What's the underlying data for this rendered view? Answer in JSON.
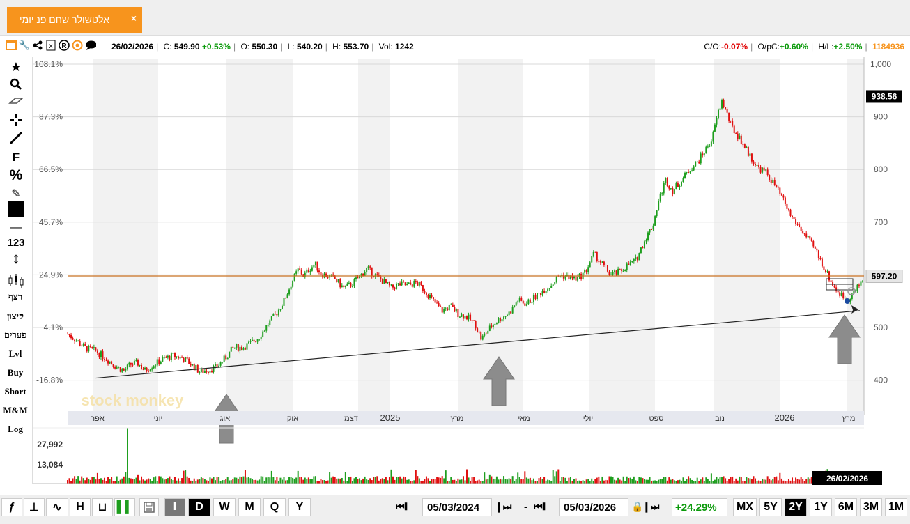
{
  "tab": {
    "title": "אלטשולר שחם פנ יומי",
    "close": "×"
  },
  "header": {
    "date": "26/02/2026",
    "close_label": "C:",
    "close": "549.90",
    "close_change": "+0.53%",
    "open_label": "O:",
    "open": "550.30",
    "low_label": "L:",
    "low": "540.20",
    "high_label": "H:",
    "high": "553.70",
    "vol_label": "Vol:",
    "vol": "1242",
    "co_label": "C/O:",
    "co": "-0.07%",
    "opc_label": "O/pC:",
    "opc": "+0.60%",
    "hl_label": "H/L:",
    "hl": "+2.50%",
    "id": "1184936"
  },
  "left_tools": [
    {
      "name": "star-icon",
      "label": "★"
    },
    {
      "name": "zoom-icon",
      "label": "🔍"
    },
    {
      "name": "eraser-icon",
      "label": "⌫"
    },
    {
      "name": "crosshair-icon",
      "label": "✛"
    },
    {
      "name": "line-tool-icon",
      "label": "╱"
    },
    {
      "name": "fib-tool",
      "label": "F"
    },
    {
      "name": "percent-tool",
      "label": "%"
    },
    {
      "name": "edit-icon",
      "label": "✎"
    },
    {
      "name": "color-swatch",
      "label": ""
    },
    {
      "name": "line-width-icon",
      "label": "—"
    },
    {
      "name": "number-tool",
      "label": "123"
    },
    {
      "name": "vertical-arrow-icon",
      "label": "↕"
    },
    {
      "name": "candle-icon",
      "label": "⫼"
    }
  ],
  "left_words": [
    "רצף",
    "קיצון",
    "פערים",
    "Lvl",
    "Buy",
    "Short",
    "M&M",
    "Log"
  ],
  "watermark": "stock monkey",
  "colors": {
    "up": "#1e9e1e",
    "down": "#e01010",
    "orange": "#f7941d",
    "hline": "#c87020",
    "arrow": "#8c8c8c"
  },
  "chart_data": {
    "type": "candlestick",
    "x_range": [
      "2024-03-05",
      "2026-03-05"
    ],
    "y_right_ticks": [
      "1,000",
      "900",
      "800",
      "700",
      "600",
      "500",
      "400"
    ],
    "y_left_ticks": [
      "108.1%",
      "87.3%",
      "66.5%",
      "45.7%",
      "24.9%",
      "4.1%",
      "-16.8%"
    ],
    "x_ticks": [
      "אפר",
      "יוני",
      "אוג",
      "אוק",
      "דצמ",
      "2025",
      "מרץ",
      "מאי",
      "יולי",
      "ספט",
      "נוב",
      "2026",
      "מרץ"
    ],
    "close_series": [
      [
        0,
        488
      ],
      [
        5,
        478
      ],
      [
        12,
        462
      ],
      [
        20,
        455
      ],
      [
        28,
        440
      ],
      [
        35,
        425
      ],
      [
        40,
        418
      ],
      [
        45,
        430
      ],
      [
        50,
        432
      ],
      [
        55,
        418
      ],
      [
        60,
        428
      ],
      [
        68,
        440
      ],
      [
        75,
        446
      ],
      [
        82,
        442
      ],
      [
        88,
        430
      ],
      [
        94,
        416
      ],
      [
        100,
        420
      ],
      [
        106,
        425
      ],
      [
        112,
        442
      ],
      [
        118,
        462
      ],
      [
        124,
        462
      ],
      [
        130,
        470
      ],
      [
        136,
        482
      ],
      [
        142,
        505
      ],
      [
        148,
        525
      ],
      [
        154,
        552
      ],
      [
        160,
        590
      ],
      [
        164,
        610
      ],
      [
        168,
        598
      ],
      [
        172,
        612
      ],
      [
        176,
        620
      ],
      [
        180,
        602
      ],
      [
        185,
        598
      ],
      [
        190,
        592
      ],
      [
        196,
        575
      ],
      [
        202,
        582
      ],
      [
        208,
        598
      ],
      [
        213,
        612
      ],
      [
        218,
        600
      ],
      [
        224,
        588
      ],
      [
        230,
        575
      ],
      [
        236,
        582
      ],
      [
        242,
        580
      ],
      [
        248,
        585
      ],
      [
        254,
        570
      ],
      [
        260,
        550
      ],
      [
        266,
        532
      ],
      [
        272,
        540
      ],
      [
        278,
        525
      ],
      [
        284,
        520
      ],
      [
        290,
        505
      ],
      [
        294,
        478
      ],
      [
        298,
        492
      ],
      [
        303,
        508
      ],
      [
        308,
        518
      ],
      [
        314,
        528
      ],
      [
        320,
        552
      ],
      [
        326,
        545
      ],
      [
        332,
        558
      ],
      [
        338,
        570
      ],
      [
        344,
        582
      ],
      [
        350,
        600
      ],
      [
        356,
        596
      ],
      [
        362,
        592
      ],
      [
        368,
        605
      ],
      [
        374,
        640
      ],
      [
        380,
        620
      ],
      [
        386,
        600
      ],
      [
        392,
        605
      ],
      [
        398,
        618
      ],
      [
        404,
        628
      ],
      [
        410,
        665
      ],
      [
        416,
        695
      ],
      [
        420,
        740
      ],
      [
        425,
        780
      ],
      [
        430,
        760
      ],
      [
        436,
        778
      ],
      [
        442,
        800
      ],
      [
        448,
        815
      ],
      [
        454,
        840
      ],
      [
        458,
        858
      ],
      [
        462,
        905
      ],
      [
        465,
        930
      ],
      [
        468,
        910
      ],
      [
        472,
        880
      ],
      [
        478,
        858
      ],
      [
        484,
        830
      ],
      [
        490,
        805
      ],
      [
        496,
        795
      ],
      [
        502,
        772
      ],
      [
        508,
        745
      ],
      [
        514,
        712
      ],
      [
        520,
        690
      ],
      [
        526,
        668
      ],
      [
        532,
        645
      ],
      [
        538,
        612
      ],
      [
        544,
        580
      ],
      [
        550,
        560
      ],
      [
        555,
        556
      ],
      [
        560,
        570
      ],
      [
        565,
        592
      ]
    ],
    "last_price": "597.20",
    "marked_price": "938.56",
    "horizontal_level": 597.2,
    "trendline": [
      [
        20,
        404
      ],
      [
        563,
        532
      ]
    ],
    "support_points": [
      "2024-08",
      "2025-04",
      "2026-02"
    ],
    "volume_ticks": [
      "27,992",
      "13,084"
    ],
    "last_date": "26/02/2026"
  },
  "bottom": {
    "chart_type_buttons": [
      "ƒ",
      "⊥",
      "∿",
      "H",
      "⊔",
      "▌▌"
    ],
    "interval_buttons": [
      "I",
      "D",
      "W",
      "M",
      "Q",
      "Y"
    ],
    "from_date": "05/03/2024",
    "dash": "-",
    "to_date": "05/03/2026",
    "change": "+24.29%",
    "range_buttons": [
      "MX",
      "5Y",
      "2Y",
      "1Y",
      "6M",
      "3M",
      "1M"
    ]
  }
}
